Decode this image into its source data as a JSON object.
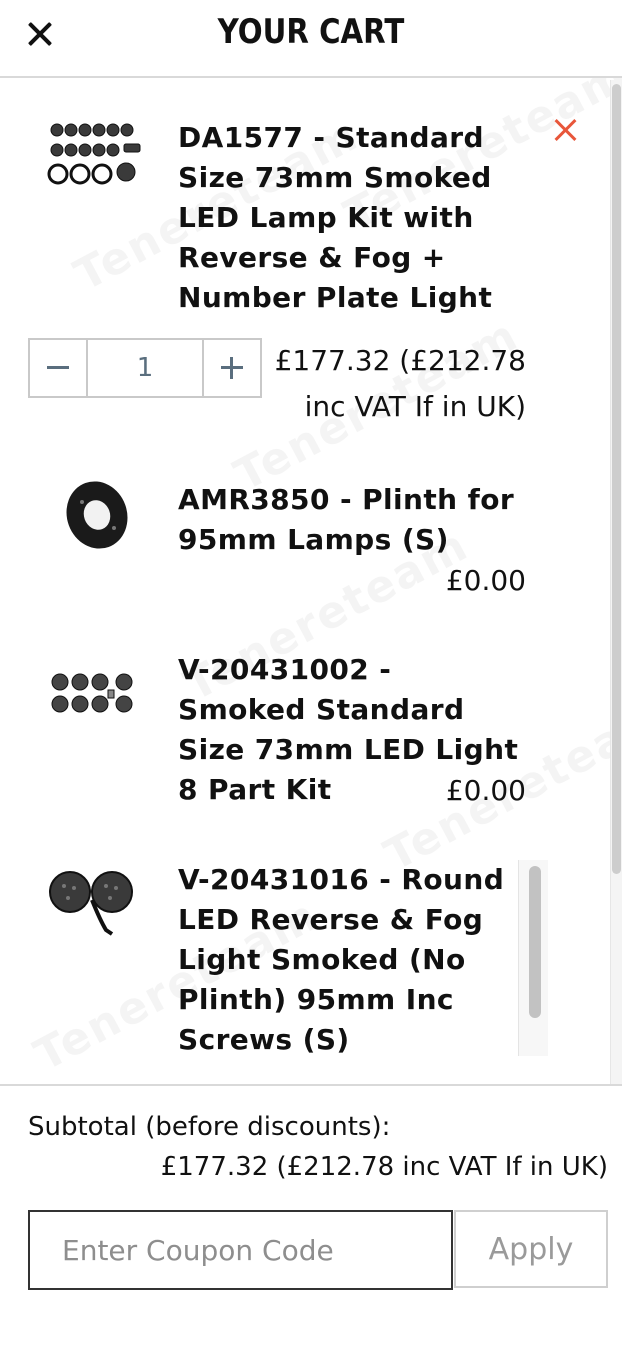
{
  "header": {
    "title": "YOUR CART"
  },
  "icons": {
    "close": "close-icon",
    "remove": "remove-item-icon",
    "minus": "minus-icon",
    "plus": "plus-icon"
  },
  "watermark_text": "Tenereteam",
  "items": [
    {
      "name": "DA1577 - Standard Size 73mm Smoked LED Lamp Kit with Reverse & Fog + Number Plate Light",
      "price": "£177.32 (£212.78 inc VAT If in UK)",
      "quantity": "1"
    },
    {
      "name": "AMR3850 - Plinth for 95mm Lamps (S)",
      "price": "£0.00"
    },
    {
      "name": "V-20431002 - Smoked Standard Size 73mm LED Light 8 Part Kit",
      "price": "£0.00"
    },
    {
      "name": "V-20431016 - Round LED Reverse & Fog Light Smoked (No Plinth) 95mm Inc Screws (S)"
    }
  ],
  "footer": {
    "subtotal_label": "Subtotal (before discounts):",
    "subtotal_value": "£177.32 (£212.78 inc VAT If in UK)",
    "coupon_placeholder": "Enter Coupon Code",
    "apply_label": "Apply"
  },
  "colors": {
    "remove_icon": "#e8563a",
    "qty_text": "#5a6e7e"
  }
}
